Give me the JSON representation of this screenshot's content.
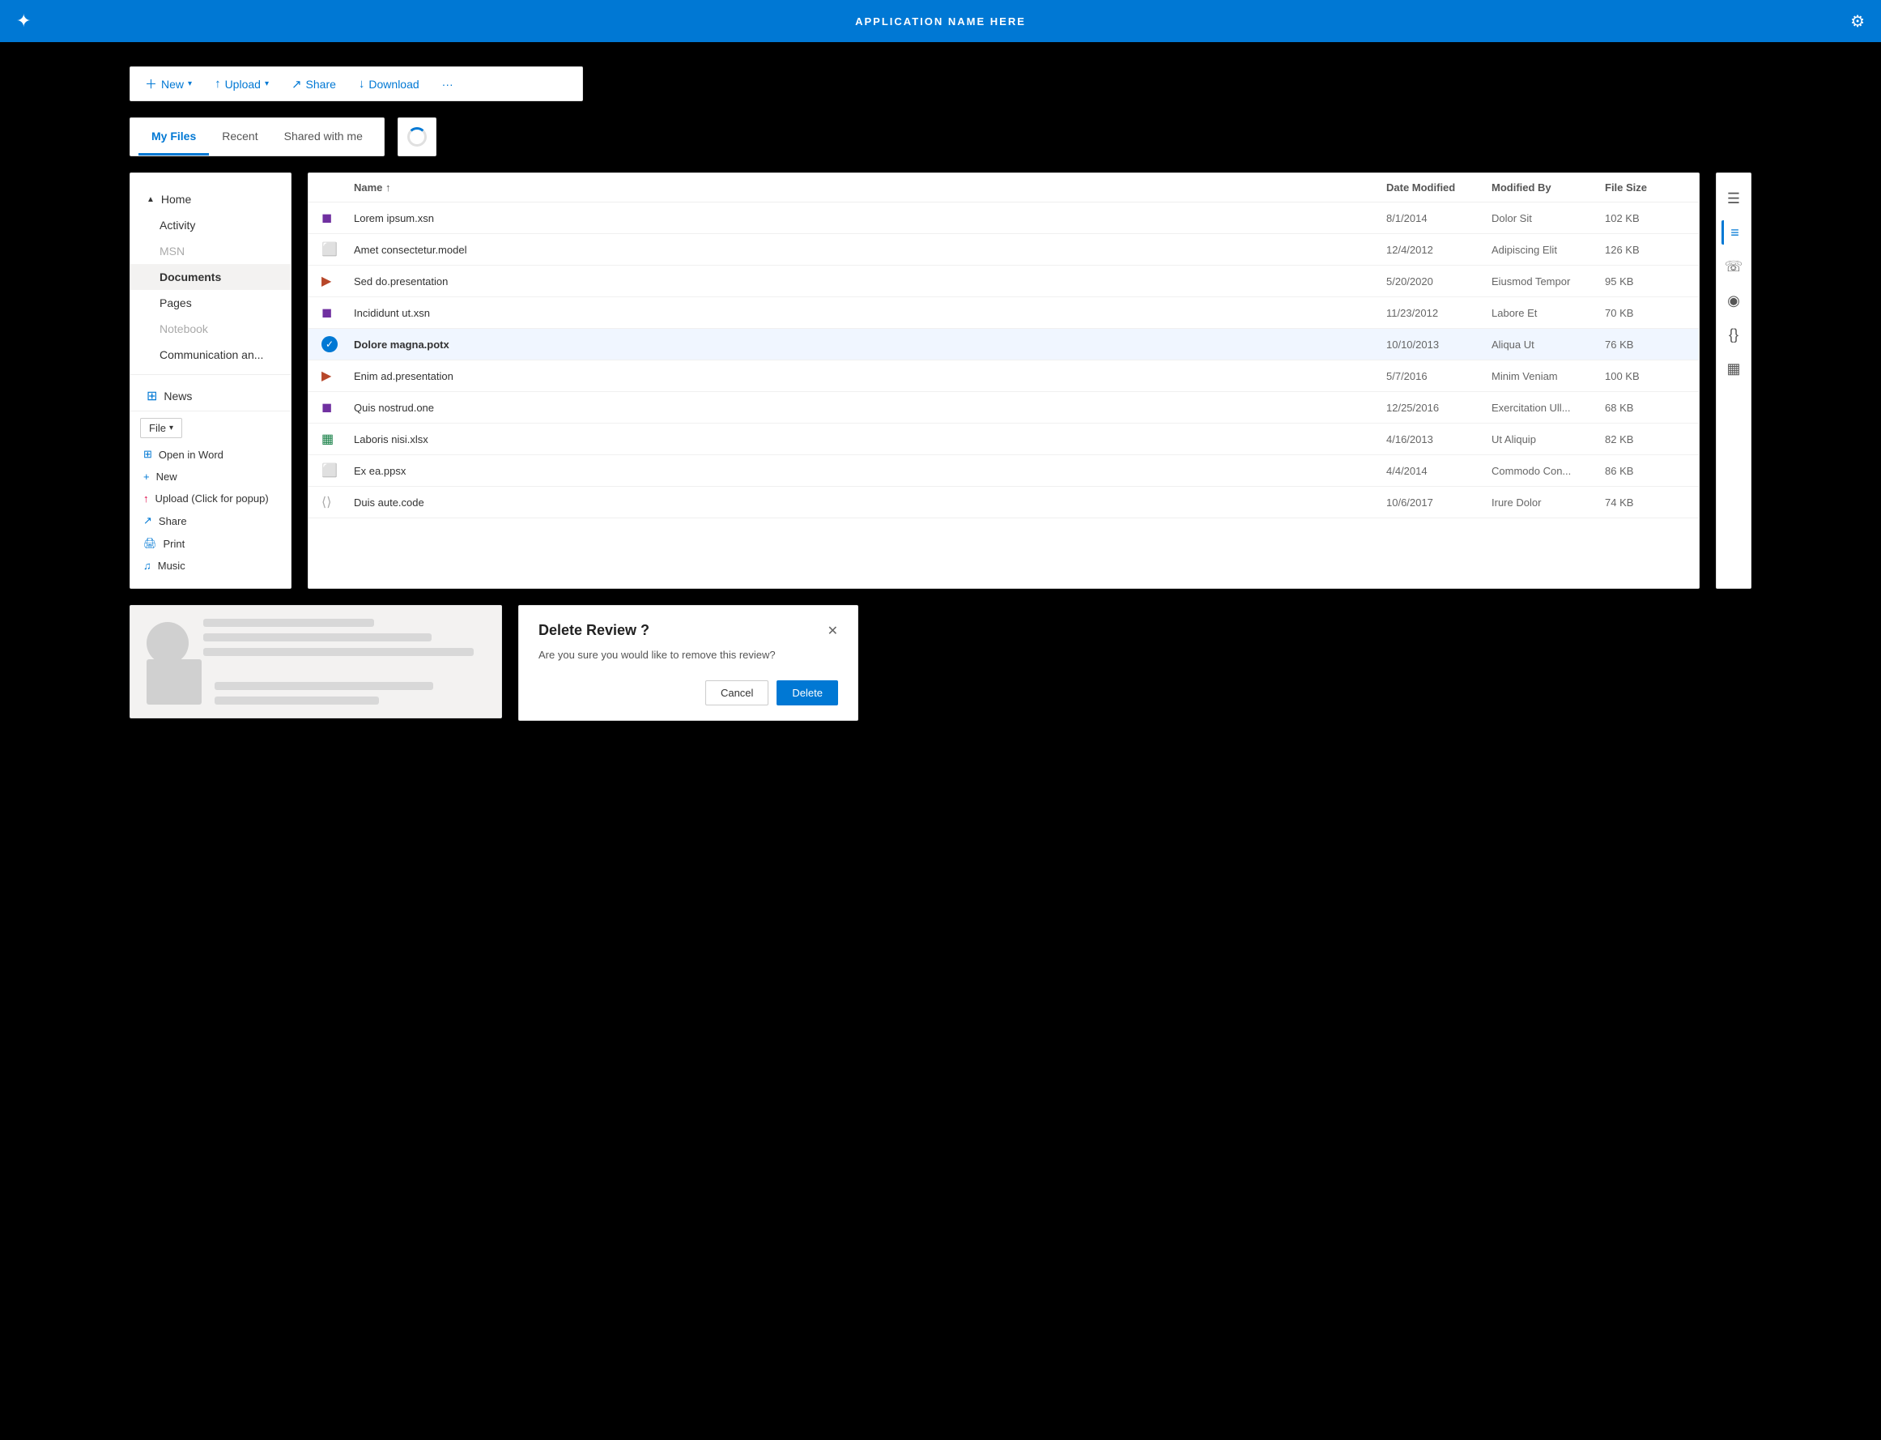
{
  "app": {
    "title": "APPLICATION NAME HERE",
    "logo_icon": "✦",
    "settings_icon": "⚙"
  },
  "toolbar": {
    "new_label": "New",
    "upload_label": "Upload",
    "share_label": "Share",
    "download_label": "Download",
    "more_label": "···"
  },
  "tabs": {
    "items": [
      {
        "label": "My Files",
        "active": true
      },
      {
        "label": "Recent",
        "active": false
      },
      {
        "label": "Shared with me",
        "active": false
      }
    ]
  },
  "sidebar": {
    "home_label": "Home",
    "items": [
      {
        "label": "Activity",
        "indent": true,
        "active": false,
        "muted": false
      },
      {
        "label": "MSN",
        "indent": true,
        "active": false,
        "muted": true
      },
      {
        "label": "Documents",
        "indent": true,
        "active": true,
        "muted": false
      },
      {
        "label": "Pages",
        "indent": true,
        "active": false,
        "muted": false
      },
      {
        "label": "Notebook",
        "indent": true,
        "active": false,
        "muted": true
      },
      {
        "label": "Communication an...",
        "indent": true,
        "active": false,
        "muted": false
      }
    ],
    "news_label": "News",
    "context_btn": "File",
    "context_items": [
      {
        "label": "Open in Word",
        "icon": "⊞"
      },
      {
        "label": "New",
        "icon": "+"
      },
      {
        "label": "Upload (Click for popup)",
        "icon": "↑"
      },
      {
        "label": "Share",
        "icon": "↗"
      },
      {
        "label": "Print",
        "icon": "🖨"
      },
      {
        "label": "Music",
        "icon": "♫"
      }
    ]
  },
  "file_list": {
    "columns": [
      "Name ↑",
      "Date Modified",
      "Modified By",
      "File Size"
    ],
    "files": [
      {
        "name": "Lorem ipsum.xsn",
        "type": "xsn",
        "date": "8/1/2014",
        "by": "Dolor Sit",
        "size": "102 KB",
        "selected": false
      },
      {
        "name": "Amet consectetur.model",
        "type": "model",
        "date": "12/4/2012",
        "by": "Adipiscing Elit",
        "size": "126 KB",
        "selected": false
      },
      {
        "name": "Sed do.presentation",
        "type": "pptx",
        "date": "5/20/2020",
        "by": "Eiusmod Tempor",
        "size": "95 KB",
        "selected": false
      },
      {
        "name": "Incididunt ut.xsn",
        "type": "xsn",
        "date": "11/23/2012",
        "by": "Labore Et",
        "size": "70 KB",
        "selected": false
      },
      {
        "name": "Dolore magna.potx",
        "type": "potx",
        "date": "10/10/2013",
        "by": "Aliqua Ut",
        "size": "76 KB",
        "selected": true
      },
      {
        "name": "Enim ad.presentation",
        "type": "pptx",
        "date": "5/7/2016",
        "by": "Minim Veniam",
        "size": "100 KB",
        "selected": false
      },
      {
        "name": "Quis nostrud.one",
        "type": "one",
        "date": "12/25/2016",
        "by": "Exercitation Ull...",
        "size": "68 KB",
        "selected": false
      },
      {
        "name": "Laboris nisi.xlsx",
        "type": "xlsx",
        "date": "4/16/2013",
        "by": "Ut Aliquip",
        "size": "82 KB",
        "selected": false
      },
      {
        "name": "Ex ea.ppsx",
        "type": "ppsx",
        "date": "4/4/2014",
        "by": "Commodo Con...",
        "size": "86 KB",
        "selected": false
      },
      {
        "name": "Duis aute.code",
        "type": "code",
        "date": "10/6/2017",
        "by": "Irure Dolor",
        "size": "74 KB",
        "selected": false
      }
    ]
  },
  "right_panel": {
    "icons": [
      {
        "name": "menu-icon",
        "glyph": "☰"
      },
      {
        "name": "list-icon",
        "glyph": "≡",
        "active": true
      },
      {
        "name": "phone-icon",
        "glyph": "☏"
      },
      {
        "name": "wifi-icon",
        "glyph": "◎"
      },
      {
        "name": "code-icon",
        "glyph": "{}"
      },
      {
        "name": "chart-icon",
        "glyph": "▦"
      }
    ]
  },
  "delete_dialog": {
    "title": "Delete Review ?",
    "body": "Are you sure you would like to remove this review?",
    "cancel_label": "Cancel",
    "delete_label": "Delete",
    "close_icon": "✕"
  }
}
